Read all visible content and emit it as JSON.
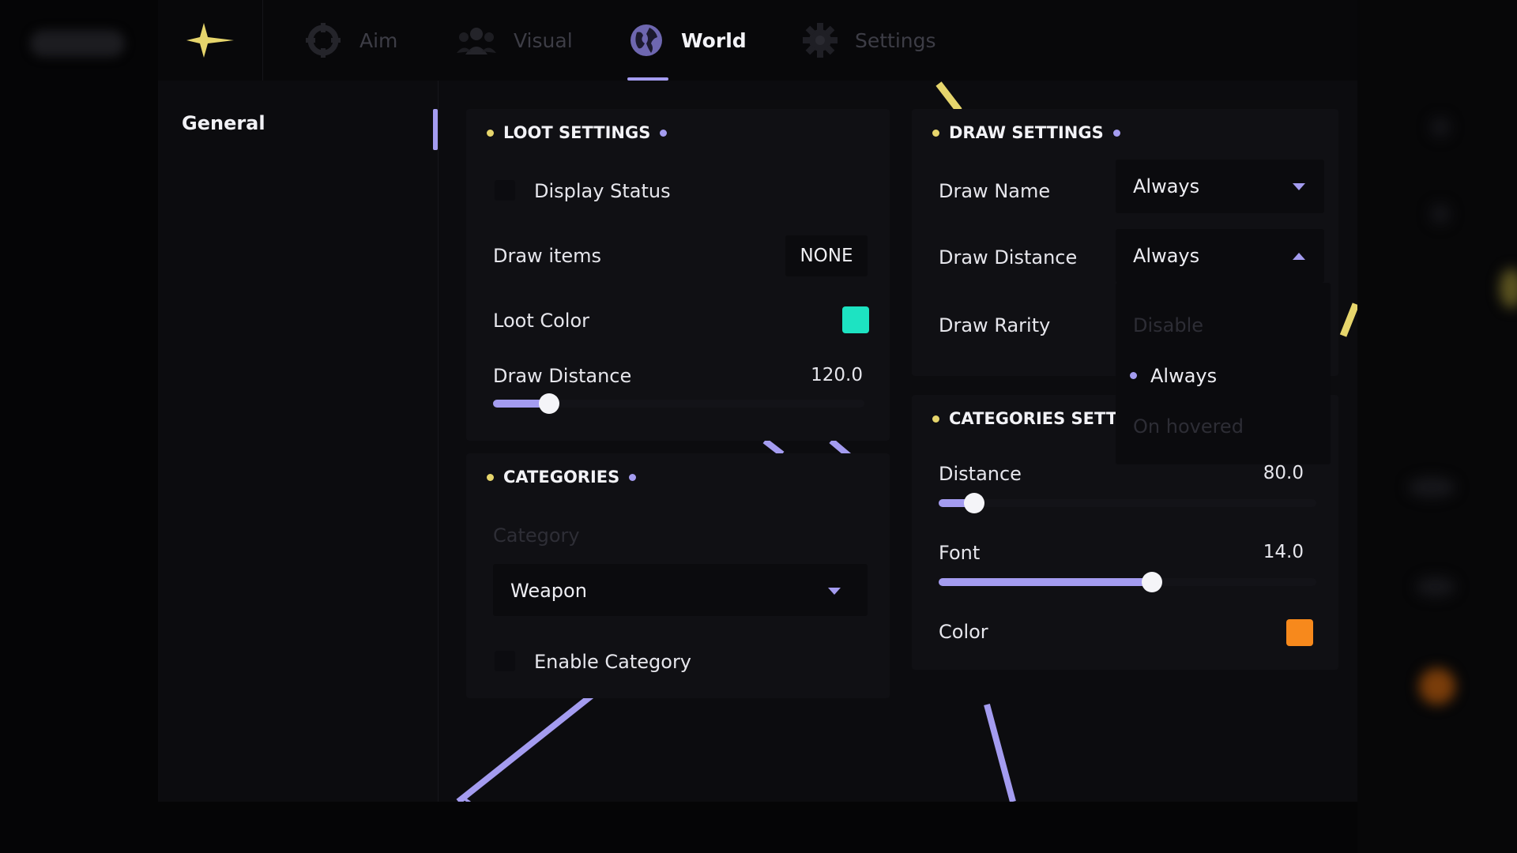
{
  "colors": {
    "accent": "#a49cf0",
    "gold": "#e6d56c",
    "loot_color": "#1de3c2",
    "category_color": "#f7891c"
  },
  "topbar": {
    "logo_icon": "sparkle-star-icon",
    "tabs": [
      {
        "label": "Aim",
        "icon": "crosshair-icon",
        "active": false
      },
      {
        "label": "Visual",
        "icon": "users-icon",
        "active": false
      },
      {
        "label": "World",
        "icon": "globe-icon",
        "active": true
      },
      {
        "label": "Settings",
        "icon": "gear-icon",
        "active": false
      }
    ]
  },
  "sidebar": {
    "items": [
      {
        "label": "General",
        "active": true
      }
    ]
  },
  "loot_settings": {
    "title": "LOOT SETTINGS",
    "display_status": {
      "label": "Display Status",
      "checked": false
    },
    "draw_items": {
      "label": "Draw items",
      "value": "NONE"
    },
    "loot_color": {
      "label": "Loot Color"
    },
    "draw_distance": {
      "label": "Draw Distance",
      "value": "120.0",
      "fill_fraction": 0.15
    }
  },
  "categories": {
    "title": "CATEGORIES",
    "category_label": "Category",
    "category_value": "Weapon",
    "enable_category": {
      "label": "Enable Category",
      "checked": false
    }
  },
  "draw_settings": {
    "title": "DRAW SETTINGS",
    "draw_name": {
      "label": "Draw Name",
      "value": "Always"
    },
    "draw_distance": {
      "label": "Draw Distance",
      "value": "Always",
      "open": true
    },
    "draw_rarity": {
      "label": "Draw Rarity"
    },
    "options": [
      {
        "label": "Disable",
        "selected": false
      },
      {
        "label": "Always",
        "selected": true
      },
      {
        "label": "On hovered",
        "selected": false
      }
    ]
  },
  "categories_settings": {
    "title": "CATEGORIES SETTIN",
    "distance": {
      "label": "Distance",
      "value": "80.0",
      "fill_fraction": 0.095
    },
    "font": {
      "label": "Font",
      "value": "14.0",
      "fill_fraction": 0.565
    },
    "color": {
      "label": "Color"
    }
  }
}
